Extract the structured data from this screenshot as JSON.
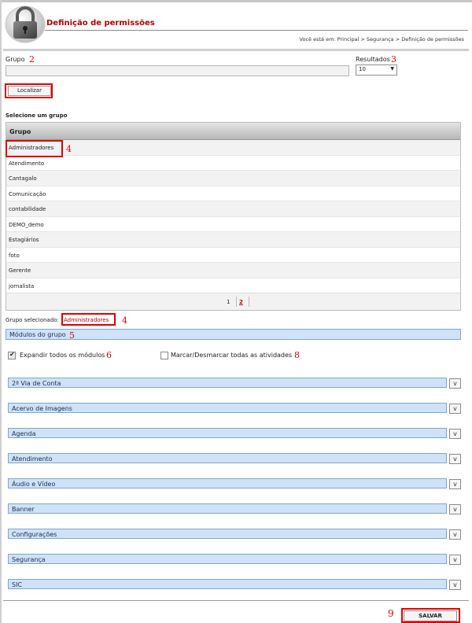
{
  "header": {
    "title": "Definição de permissões",
    "breadcrumb": "Você está em: Principal > Segurança > Definição de permissões",
    "logo_icon": "padlock-icon"
  },
  "search": {
    "grupo_label": "Grupo",
    "grupo_value": "",
    "resultados_label": "Resultados",
    "resultados_value": "10",
    "localizar_label": "Localizar"
  },
  "table": {
    "section_label": "Selecione um grupo",
    "header": "Grupo",
    "rows": [
      "Administradores",
      "Atendimento",
      "Cantagalo",
      "Comunicação",
      "contabilidade",
      "DEMO_demo",
      "Estagiários",
      "foto",
      "Gerente",
      "jornalista"
    ],
    "pages": [
      "1",
      "2"
    ]
  },
  "selected": {
    "label": "Grupo selecionado:",
    "value": "Administradores"
  },
  "modulos": {
    "header": "Módulos do grupo",
    "expand_label": "Expandir todos os módulos",
    "expand_checked": true,
    "mark_label": "Marcar/Desmarcar todas as atividades",
    "mark_checked": false,
    "items": [
      "2ª Via de Conta",
      "Acervo de Imagens",
      "Agenda",
      "Atendimento",
      "Áudio e Vídeo",
      "Banner",
      "Configurações",
      "Segurança",
      "SIC"
    ],
    "expand_button_glyph": "v"
  },
  "actions": {
    "save_label": "SALVAR"
  },
  "annotations": [
    "2",
    "3",
    "4",
    "4",
    "5",
    "6",
    "8",
    "9"
  ],
  "colors": {
    "title_red": "#b30000",
    "annotation_red": "#e00000",
    "module_bar_blue": "#cfe2f8"
  }
}
